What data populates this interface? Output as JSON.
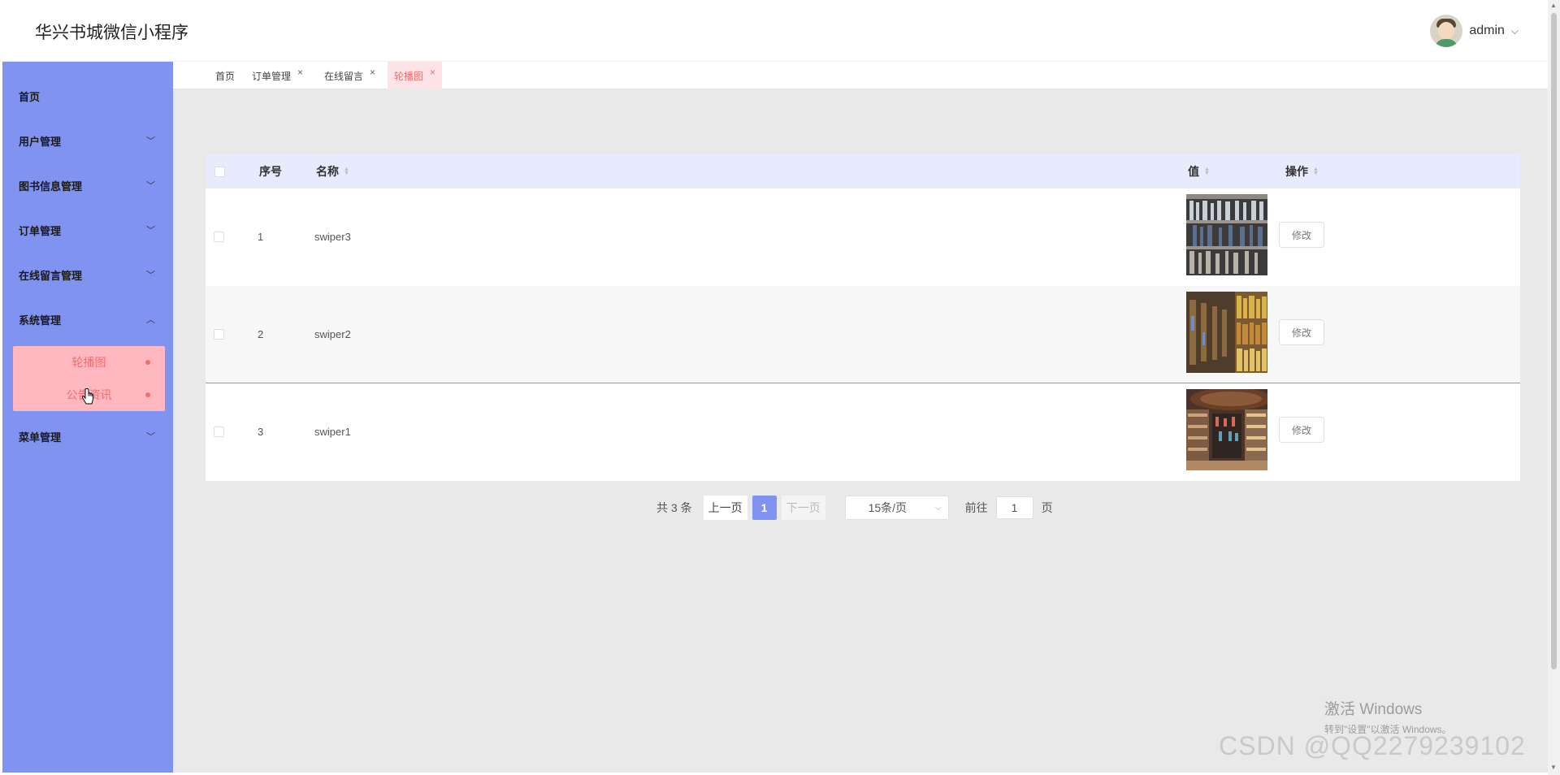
{
  "app": {
    "title": "华兴书城微信小程序"
  },
  "user": {
    "name": "admin",
    "chevron": "chevron-down-icon"
  },
  "sidebar": {
    "items": [
      {
        "label": "首页"
      },
      {
        "label": "用户管理",
        "arrow": "chevron-down"
      },
      {
        "label": "图书信息管理",
        "arrow": "chevron-down"
      },
      {
        "label": "订单管理",
        "arrow": "chevron-down"
      },
      {
        "label": "在线留言管理",
        "arrow": "chevron-down"
      },
      {
        "label": "系统管理",
        "arrow": "chevron-up"
      },
      {
        "label": "菜单管理",
        "arrow": "chevron-down"
      }
    ],
    "submenu": [
      {
        "label": "轮播图",
        "active": true
      },
      {
        "label": "公告资讯"
      }
    ]
  },
  "tabs": [
    {
      "label": "首页"
    },
    {
      "label": "订单管理",
      "close": "×"
    },
    {
      "label": "在线留言",
      "close": "×"
    },
    {
      "label": "轮播图",
      "close": "×",
      "active": true
    }
  ],
  "table": {
    "columns": {
      "index": "序号",
      "name": "名称",
      "value": "值",
      "action": "操作"
    },
    "rows": [
      {
        "index": "1",
        "name": "swiper3",
        "action": "修改"
      },
      {
        "index": "2",
        "name": "swiper2",
        "action": "修改"
      },
      {
        "index": "3",
        "name": "swiper1",
        "action": "修改"
      }
    ]
  },
  "pagination": {
    "total": "共 3 条",
    "prev": "上一页",
    "current": "1",
    "next": "下一页",
    "page_size": "15条/页",
    "goto_label": "前往",
    "goto_value": "1",
    "page_suffix": "页"
  },
  "watermark": {
    "windows_line1": "激活 Windows",
    "windows_line2": "转到\"设置\"以激活 Windows。",
    "csdn": "CSDN @QQ2279239102"
  },
  "colors": {
    "sidebar": "#8093f1",
    "submenu_active_bg": "#ffb8c0",
    "accent_red": "#f56c6c",
    "table_header": "#e8ebfd",
    "content_bg": "#e9e9e9"
  }
}
